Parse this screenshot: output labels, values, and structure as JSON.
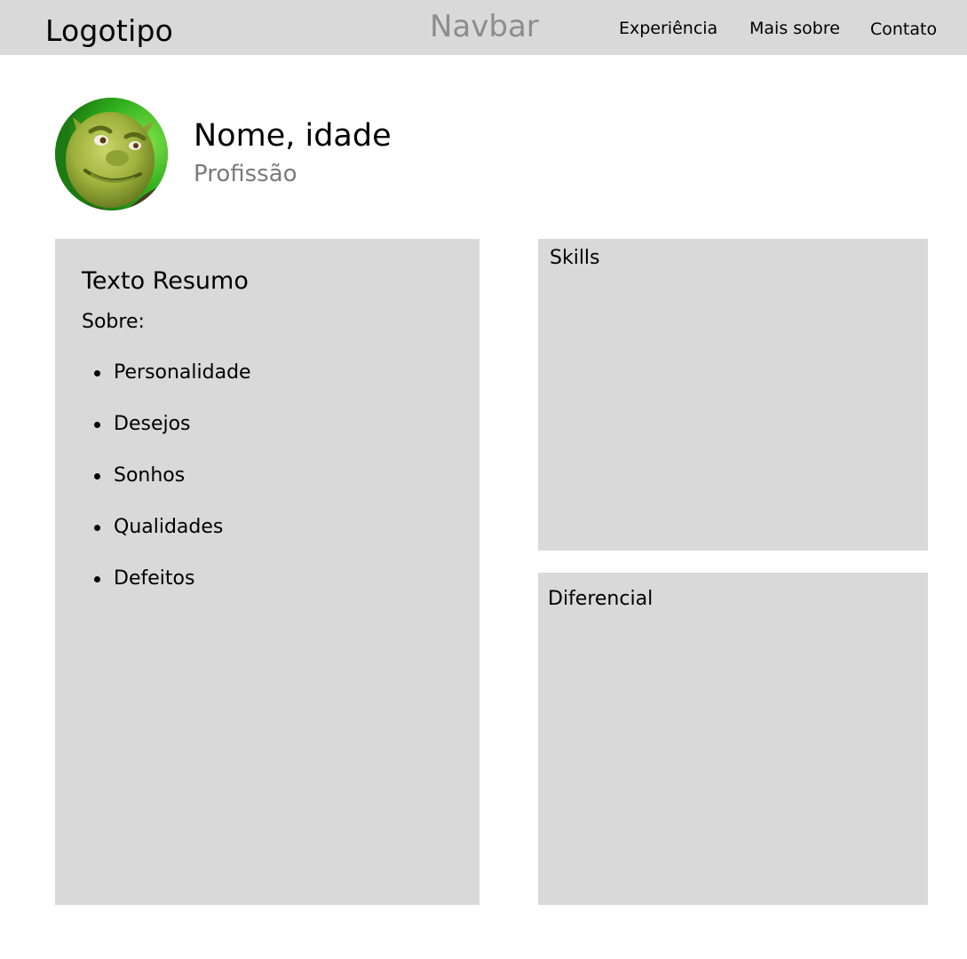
{
  "navbar": {
    "logo": "Logotipo",
    "title": "Navbar",
    "links": [
      "Experiência",
      "Mais sobre",
      "Contato"
    ]
  },
  "profile": {
    "name": "Nome, idade",
    "profession": "Profissão",
    "avatar_icon": "profile-photo"
  },
  "summary": {
    "title": "Texto Resumo",
    "subtitle": "Sobre:",
    "items": [
      "Personalidade",
      "Desejos",
      "Sonhos",
      "Qualidades",
      "Defeitos"
    ]
  },
  "skills": {
    "label": "Skills"
  },
  "diferencial": {
    "label": "Diferencial"
  },
  "colors": {
    "panel": "#d9d9d9",
    "navbar": "#d9d9d9",
    "muted_text": "#7a7a7a"
  }
}
